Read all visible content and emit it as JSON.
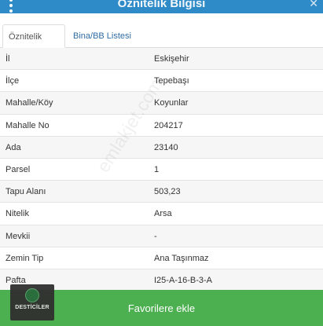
{
  "header": {
    "title": "Öznitelik Bilgisi",
    "menu_icon": "kebab-menu-icon",
    "close_icon": "close-icon"
  },
  "tabs": [
    {
      "label": "Öznitelik Bilgisi",
      "active": true
    },
    {
      "label": "Bina/BB Listesi",
      "active": false
    }
  ],
  "attributes": [
    {
      "key": "İl",
      "value": "Eskişehir"
    },
    {
      "key": "İlçe",
      "value": "Tepebaşı"
    },
    {
      "key": "Mahalle/Köy",
      "value": "Koyunlar"
    },
    {
      "key": "Mahalle No",
      "value": "204217"
    },
    {
      "key": "Ada",
      "value": "23140"
    },
    {
      "key": "Parsel",
      "value": "1"
    },
    {
      "key": "Tapu Alanı",
      "value": "503,23"
    },
    {
      "key": "Nitelik",
      "value": "Arsa"
    },
    {
      "key": "Mevkii",
      "value": "-"
    },
    {
      "key": "Zemin Tip",
      "value": "Ana Taşınmaz"
    },
    {
      "key": "Pafta",
      "value": "I25-A-16-B-3-A"
    }
  ],
  "footer": {
    "favorite_label": "Favorilere ekle"
  },
  "logo": {
    "name": "DESTİCİLER"
  },
  "watermark": {
    "text": "emlakjet.com"
  },
  "colors": {
    "header": "#2e8bc7",
    "button": "#4caf50",
    "link": "#2e6da4"
  }
}
